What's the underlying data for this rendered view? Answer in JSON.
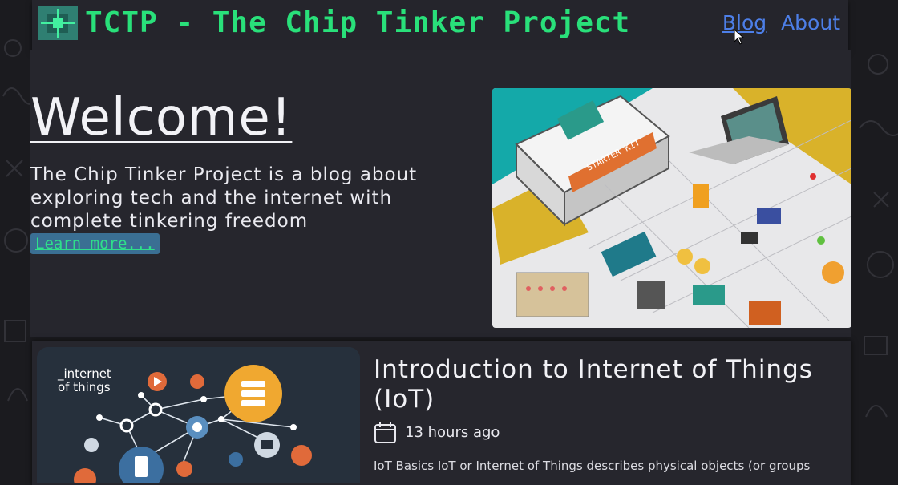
{
  "header": {
    "title": "TCTP - The Chip Tinker Project",
    "nav": [
      {
        "label": "Blog"
      },
      {
        "label": "About"
      }
    ]
  },
  "hero": {
    "heading": "Welcome!",
    "tagline": "The Chip Tinker Project is a blog about exploring tech and the internet with complete tinkering freedom",
    "button_label": "Learn more...",
    "image_text": "STARTER KIT"
  },
  "post": {
    "thumb_text_line1": "_internet",
    "thumb_text_line2": "of things",
    "title": "Introduction to Internet of Things (IoT)",
    "time": "13 hours ago",
    "excerpt": "IoT Basics IoT or Internet of Things describes physical objects (or groups"
  },
  "icons": {
    "logo": "chip-icon",
    "calendar": "calendar-icon",
    "cursor": "cursor-icon"
  },
  "colors": {
    "accent_green": "#29e07a",
    "link_blue": "#4d7fe8",
    "button_bg": "#3a6f93",
    "page_bg": "#1b1b1f",
    "panel_bg": "#26262d"
  }
}
